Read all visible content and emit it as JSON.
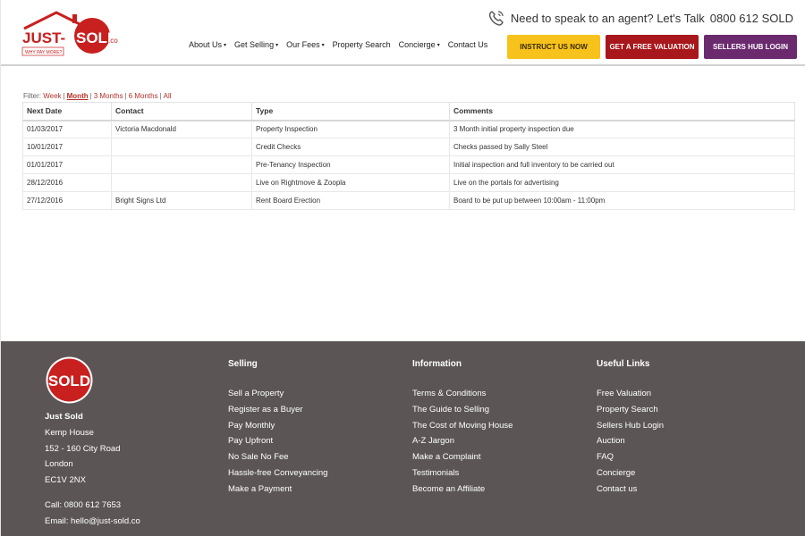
{
  "header": {
    "logo_text": "JUST-SOLD",
    "logo_suffix": ".co",
    "logo_tagline": "WHY PAY MORE?",
    "phone_prompt": "Need to speak to an agent? Let's Talk",
    "phone_number": "0800 612 SOLD",
    "nav": [
      {
        "label": "About Us",
        "dropdown": true
      },
      {
        "label": "Get Selling",
        "dropdown": true
      },
      {
        "label": "Our Fees",
        "dropdown": true
      },
      {
        "label": "Property Search",
        "dropdown": false
      },
      {
        "label": "Concierge",
        "dropdown": true
      },
      {
        "label": "Contact Us",
        "dropdown": false
      }
    ],
    "cta_instruct": "INSTRUCT US NOW",
    "cta_valuation": "GET A FREE VALUATION",
    "cta_hub": "SELLERS HUB LOGIN"
  },
  "filter": {
    "label": "Filter:",
    "options": [
      "Week",
      "Month",
      "3 Months",
      "6 Months",
      "All"
    ],
    "active": "Month"
  },
  "table": {
    "headers": [
      "Next Date",
      "Contact",
      "Type",
      "Comments"
    ],
    "rows": [
      [
        "01/03/2017",
        "Victoria Macdonald",
        "Property Inspection",
        "3 Month initial property inspection due"
      ],
      [
        "10/01/2017",
        "",
        "Credit Checks",
        "Checks passed by Sally Steel"
      ],
      [
        "01/01/2017",
        "",
        "Pre-Tenancy Inspection",
        "Initial inspection and full inventory to be carried out"
      ],
      [
        "28/12/2016",
        "",
        "Live on Rightmove & Zoopla",
        "Live on the portals for advertising"
      ],
      [
        "27/12/2016",
        "Bright Signs Ltd",
        "Rent Board Erection",
        "Board to be put up between 10:00am - 11:00pm"
      ]
    ]
  },
  "footer": {
    "badge_text": "SOLD",
    "company": "Just Sold",
    "address": [
      "Kemp House",
      "152 - 160 City Road",
      "London",
      "EC1V 2NX"
    ],
    "call": "Call: 0800 612 7653",
    "email": "Email: hello@just-sold.co",
    "selling": {
      "title": "Selling",
      "links": [
        "Sell a Property",
        "Register as a Buyer",
        "Pay Monthly",
        "Pay Upfront",
        "No Sale No Fee",
        "Hassle-free Conveyancing",
        "Make a Payment"
      ]
    },
    "information": {
      "title": "Information",
      "links": [
        "Terms & Conditions",
        "The Guide to Selling",
        "The Cost of Moving House",
        "A-Z Jargon",
        "Make a Complaint",
        "Testimonials",
        "Become an Affiliate"
      ]
    },
    "useful": {
      "title": "Useful Links",
      "links": [
        "Free Valuation",
        "Property Search",
        "Sellers Hub Login",
        "Auction",
        "FAQ",
        "Concierge",
        "Contact us"
      ]
    }
  },
  "colors": {
    "brand_red": "#c8201f",
    "instruct_yellow": "#f7c21b",
    "valuation_red": "#a8171b",
    "hub_purple": "#6b2a6e",
    "footer_bg": "#5b5655",
    "link_red": "#b4312a"
  },
  "icons": {
    "phone": "phone-icon",
    "logo_house": "house-roof-icon"
  }
}
